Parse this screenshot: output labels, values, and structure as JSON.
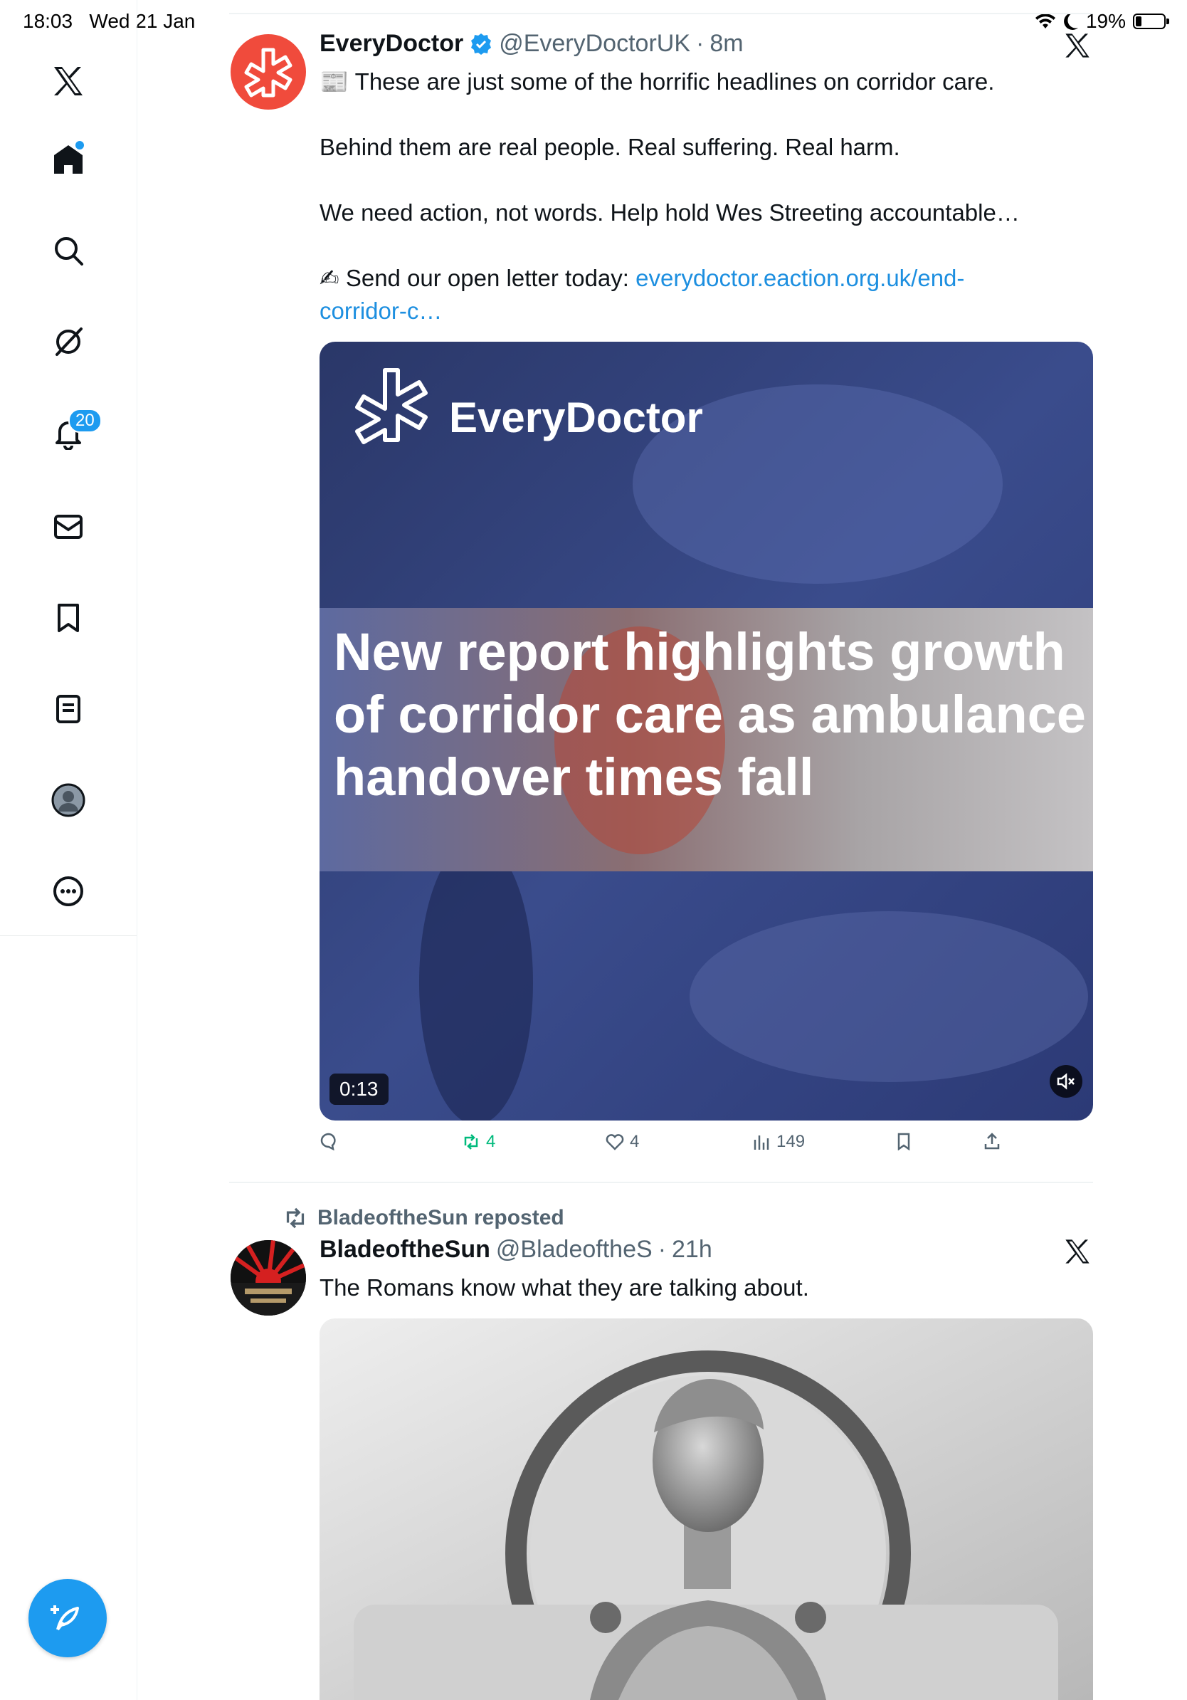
{
  "status_bar": {
    "time": "18:03",
    "date": "Wed 21 Jan",
    "battery": "19%",
    "battery_level": 0.19
  },
  "nav": {
    "notifications_badge": "20"
  },
  "tweet1": {
    "name": "EveryDoctor",
    "handle": "@EveryDoctorUK",
    "time": "8m",
    "line1_emoji": "📰",
    "line1": "These are just some of the horrific headlines on corridor care.",
    "line2": "Behind them are real people. Real suffering. Real harm.",
    "line3": "We need action, not words. Help hold Wes Streeting accountable…",
    "line4_emoji": "✍",
    "line4": "Send our open letter today:",
    "link": "everydoctor.eaction.org.uk/end-corridor-c…",
    "video": {
      "brand": "EveryDoctor",
      "headline": "New report highlights growth of corridor care as ambulance handover times fall",
      "duration": "0:13"
    },
    "stats": {
      "replies": "",
      "reposts": "4",
      "likes": "4",
      "views": "149"
    }
  },
  "tweet2": {
    "reposted_by": "BladeoftheSun reposted",
    "name": "BladeoftheSun",
    "handle": "@BladeoftheS",
    "time": "21h",
    "text": "The Romans know what they are talking about."
  },
  "colors": {
    "accent": "#1d9bf0",
    "repost": "#00ba7c",
    "avatar_red": "#f04b3c"
  }
}
